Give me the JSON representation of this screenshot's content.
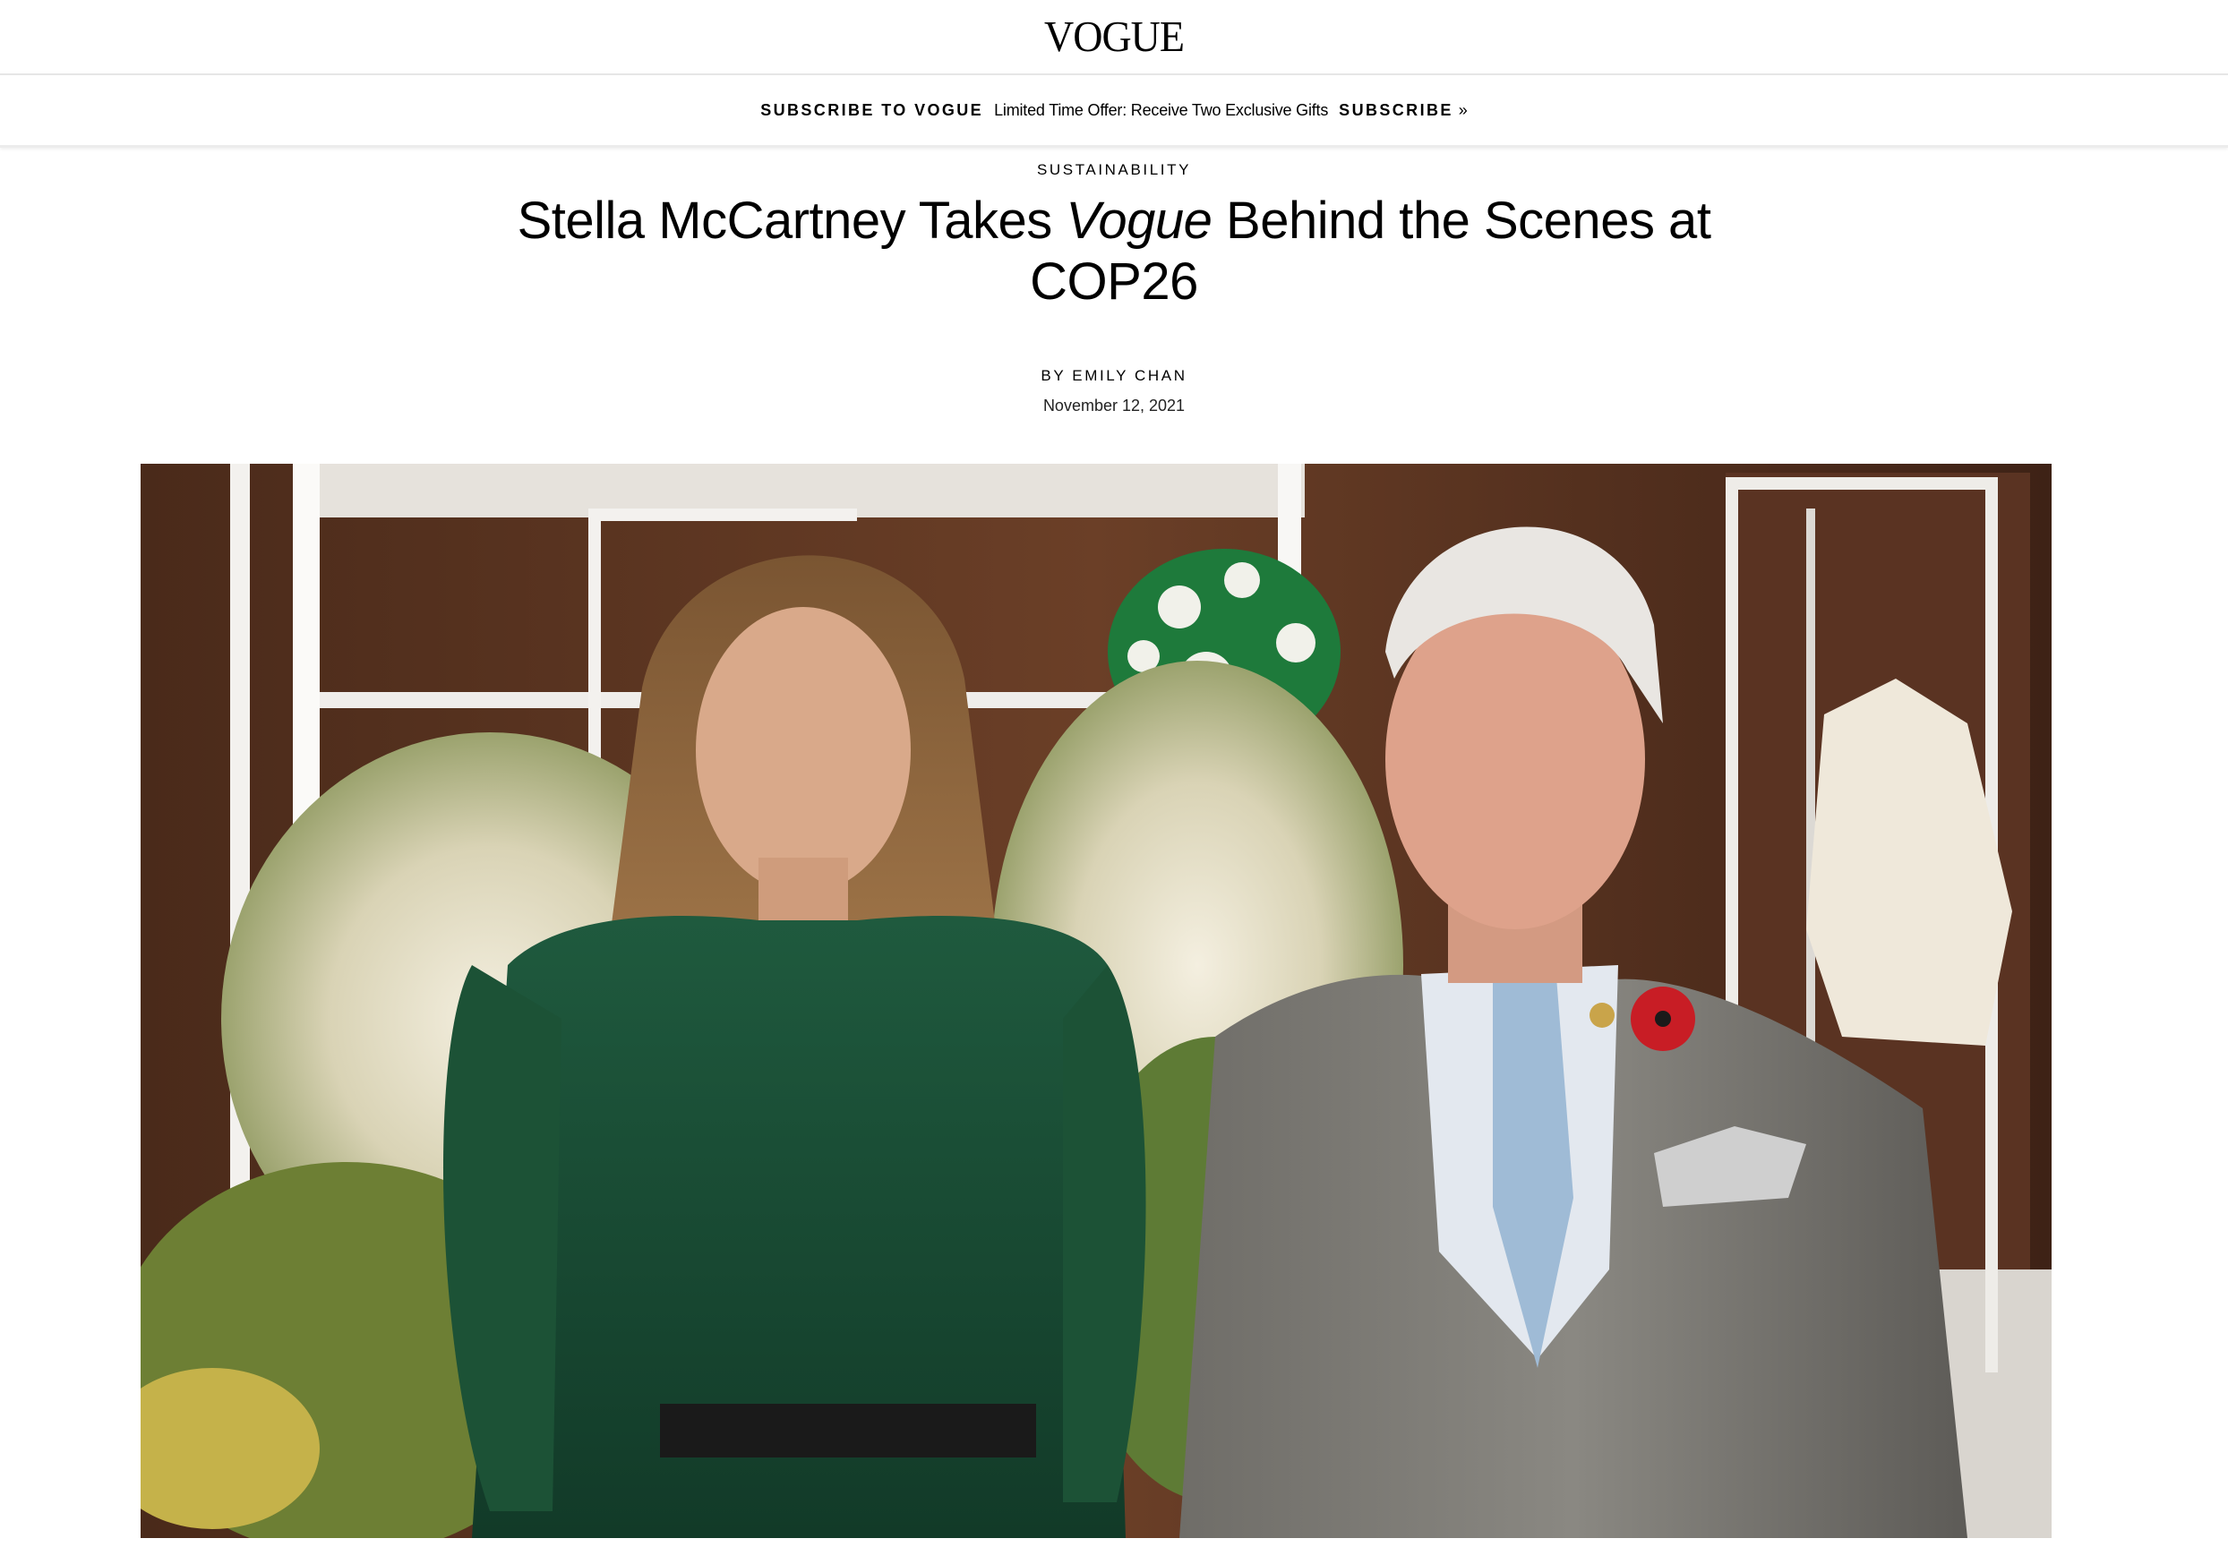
{
  "site": {
    "logo": "VOGUE"
  },
  "subscribe_bar": {
    "label": "SUBSCRIBE TO VOGUE",
    "offer": "Limited Time Offer: Receive Two Exclusive Gifts",
    "link": "SUBSCRIBE",
    "link_chevron": "»"
  },
  "article": {
    "rubric": "SUSTAINABILITY",
    "headline_part1": "Stella McCartney Takes ",
    "headline_italic": "Vogue",
    "headline_part2": " Behind the Scenes at COP26",
    "byline_prefix": "BY ",
    "author": "EMILY CHAN",
    "date": "November 12, 2021"
  },
  "colors": {
    "background": "#ffffff",
    "text": "#000000",
    "divider": "#e6e6e6"
  }
}
